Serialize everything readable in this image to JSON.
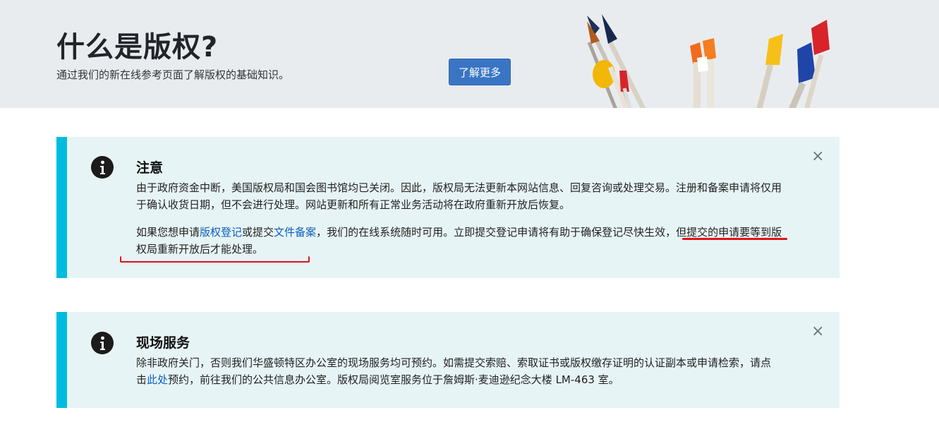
{
  "hero": {
    "title": "什么是版权?",
    "subtitle": "通过我们的新在线参考页面了解版权的基础知识。",
    "button_label": "了解更多"
  },
  "notice": {
    "title": "注意",
    "para1": "由于政府资金中断，美国版权局和国会图书馆均已关闭。因此，版权局无法更新本网站信息、回复咨询或处理交易。注册和备案申请将仅用于确认收货日期，但不会进行处理。网站更新和所有正常业务活动将在政府重新开放后恢复。",
    "para2_prefix": "如果您想申请",
    "link_registration": "版权登记",
    "para2_mid": "或提交",
    "link_recordation": "文件备案",
    "para2_suffix": "，我们的在线系统随时可用。立即提交登记申请将有助于确保登记尽快生效，但提交的申请要等到版权局重新开放后才能处理。",
    "close_symbol": "×"
  },
  "onsite": {
    "title": "现场服务",
    "text_prefix": "除非政府关门，否则我们华盛顿特区办公室的现场服务均可预约。如需提交索赔、索取证书或版权缴存证明的认证副本或申请检索，请点击",
    "link_here": "此处",
    "text_suffix": "预约，前往我们的公共信息办公室。版权局阅览室服务位于詹姆斯·麦迪逊纪念大楼 LM-463 室。",
    "close_symbol": "×"
  },
  "colors": {
    "accent_border": "#00bce0",
    "alert_bg": "#e7f4f5",
    "button_bg": "#3a75c4",
    "annotation_red": "#e0101a",
    "link": "#0b5fc0"
  },
  "icons": [
    "info-icon",
    "close-icon",
    "paintbrushes-illustration"
  ]
}
